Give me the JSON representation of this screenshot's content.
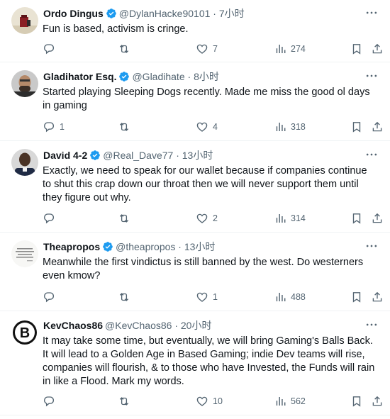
{
  "tweets": [
    {
      "name": "Ordo Dingus",
      "verified": true,
      "handle": "@DylanHacke90101",
      "dot": "·",
      "time": "7小时",
      "text": "Fun is based, activism is cringe.",
      "replies": "",
      "retweets": "",
      "likes": "7",
      "views": "274"
    },
    {
      "name": "Gladihator Esq.",
      "verified": true,
      "handle": "@Gladihate",
      "dot": "·",
      "time": "8小时",
      "text": "Started playing Sleeping Dogs recently. Made me miss the good ol days in gaming",
      "replies": "1",
      "retweets": "",
      "likes": "4",
      "views": "318"
    },
    {
      "name": "David 4-2",
      "verified": true,
      "handle": "@Real_Dave77",
      "dot": "·",
      "time": "13小时",
      "text": "Exactly, we need to speak for our wallet because if companies continue to shut this crap down our throat then we will never support them until they figure out why.",
      "replies": "",
      "retweets": "",
      "likes": "2",
      "views": "314"
    },
    {
      "name": "Theapropos",
      "verified": true,
      "handle": "@theapropos",
      "dot": "·",
      "time": "13小时",
      "text": "Meanwhile the first vindictus is still banned by the west. Do westerners even kmow?",
      "replies": "",
      "retweets": "",
      "likes": "1",
      "views": "488"
    },
    {
      "name": "KevChaos86",
      "verified": false,
      "handle": "@KevChaos86",
      "dot": "·",
      "time": "20小时",
      "text": "It may take some time, but eventually, we will bring Gaming's Balls Back. It will lead to a Golden Age in Based Gaming; indie Dev teams will rise, companies will flourish, & to those who have Invested, the Funds will rain in like a Flood. Mark my words.",
      "replies": "",
      "retweets": "",
      "likes": "10",
      "views": "562"
    }
  ],
  "colors": {
    "verified": "#1d9bf0",
    "text": "#0f1419",
    "muted": "#536471",
    "divider": "#eff3f4"
  },
  "icons": {
    "reply": "reply-icon",
    "retweet": "retweet-icon",
    "like": "heart-icon",
    "views": "views-chart-icon",
    "bookmark": "bookmark-icon",
    "share": "share-icon",
    "more": "more-dots-icon",
    "verified": "verified-badge-icon"
  }
}
